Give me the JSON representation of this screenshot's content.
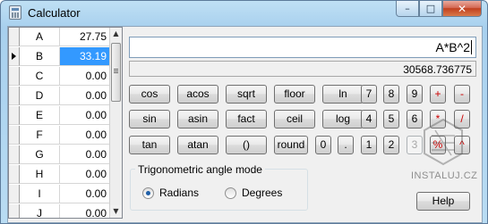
{
  "window": {
    "title": "Calculator",
    "minimize_glyph": "–",
    "maximize_glyph": "□",
    "close_glyph": "✕"
  },
  "variables": [
    {
      "name": "A",
      "value": "27.75",
      "selected": false
    },
    {
      "name": "B",
      "value": "33.19",
      "selected": true
    },
    {
      "name": "C",
      "value": "0.00",
      "selected": false
    },
    {
      "name": "D",
      "value": "0.00",
      "selected": false
    },
    {
      "name": "E",
      "value": "0.00",
      "selected": false
    },
    {
      "name": "F",
      "value": "0.00",
      "selected": false
    },
    {
      "name": "G",
      "value": "0.00",
      "selected": false
    },
    {
      "name": "H",
      "value": "0.00",
      "selected": false
    },
    {
      "name": "I",
      "value": "0.00",
      "selected": false
    },
    {
      "name": "J",
      "value": "0.00",
      "selected": false
    }
  ],
  "scrollbar": {
    "up_glyph": "▲",
    "down_glyph": "▼"
  },
  "expression": "A*B^2",
  "result": "30568.736775",
  "functions": {
    "cos": "cos",
    "acos": "acos",
    "sqrt": "sqrt",
    "floor": "floor",
    "ln": "ln",
    "sin": "sin",
    "asin": "asin",
    "fact": "fact",
    "ceil": "ceil",
    "log": "log",
    "tan": "tan",
    "atan": "atan",
    "parens": "()",
    "round": "round"
  },
  "digits": {
    "d7": "7",
    "d8": "8",
    "d9": "9",
    "d4": "4",
    "d5": "5",
    "d6": "6",
    "d0": "0",
    "dot": ".",
    "d1": "1",
    "d2": "2",
    "d3": "3"
  },
  "operators": {
    "plus": "+",
    "minus": "-",
    "multiply": "*",
    "divide": "/",
    "mod": "%",
    "power": "^"
  },
  "trig": {
    "title": "Trigonometric angle mode",
    "radians": "Radians",
    "degrees": "Degrees",
    "selected": "Radians"
  },
  "help_label": "Help",
  "watermark": "INSTALUJ.CZ"
}
